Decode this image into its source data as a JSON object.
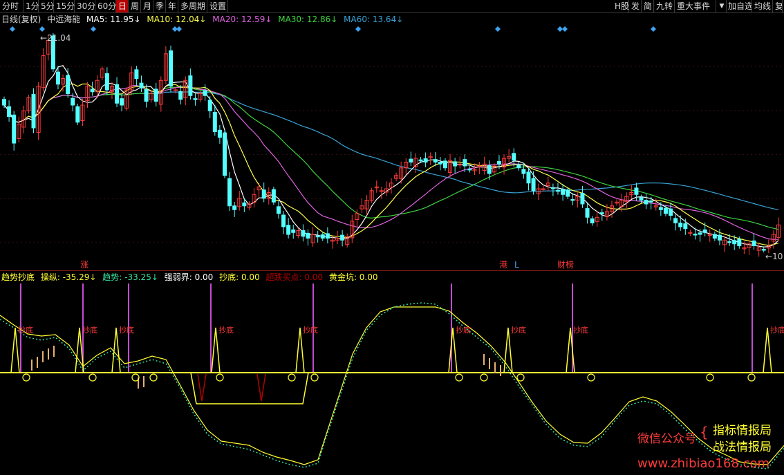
{
  "toolbar": {
    "periods": [
      "分时",
      "1分",
      "5分",
      "15分",
      "30分",
      "60分",
      "日",
      "周",
      "月",
      "季",
      "年",
      "多周期",
      "设置"
    ],
    "active_period": "日",
    "right_items": [
      "H股",
      "发",
      "简",
      "九转",
      "重大事件"
    ],
    "far_right": [
      "加自选",
      "均线",
      "复"
    ]
  },
  "main_info": {
    "chart_kind": "日线(复权)",
    "stock": "中远海能",
    "ma5": "MA5: 11.95↓",
    "ma10": "MA10: 12.04↓",
    "ma20": "MA20: 12.59↓",
    "ma30": "MA30: 12.86↓",
    "ma60": "MA60: 13.64↓"
  },
  "main_labels": {
    "high_price": "21.04",
    "low_price": "10",
    "events": [
      "涨",
      "港",
      "L",
      "财榜"
    ]
  },
  "sub_info": {
    "name": "趋势抄底",
    "caozong": "操纵: -35.29↓",
    "qushi": "趋势: -33.25↓",
    "qiangruo": "强弱界: 0.00",
    "chaodi": "抄底: 0.00",
    "chaodie": "超跌买点: 0.00",
    "huangjin": "黄金坑: 0.00"
  },
  "signal_label": "抄底",
  "watermark": {
    "wechat": "微信公众号",
    "line1": "指标情报局",
    "line2": "战法情报局",
    "url": "www.zhibiao168.com"
  },
  "colors": {
    "background": "#000000",
    "up": "#ff3b3b",
    "down": "#54ffff",
    "ma5": "#ffffff",
    "ma10": "#ffff4a",
    "ma20": "#e062e0",
    "ma30": "#3fd43f",
    "ma60": "#38a3d6",
    "signal_yellow": "#ffff32",
    "marker_purple": "#c44bd2",
    "dotted_line": "#34e0a0",
    "diamond": "#3fa3f0"
  },
  "chart_data": {
    "type": "candlestick",
    "price_axis_labels": {
      "high": 21.04,
      "low": 10
    },
    "moving_averages": [
      {
        "name": "MA5",
        "value": 11.95
      },
      {
        "name": "MA10",
        "value": 12.04
      },
      {
        "name": "MA20",
        "value": 12.59
      },
      {
        "name": "MA30",
        "value": 12.86
      },
      {
        "name": "MA60",
        "value": 13.64
      }
    ],
    "closes": [
      17.6,
      17.0,
      15.6,
      16.6,
      17.3,
      18.0,
      16.4,
      18.6,
      20.2,
      21.0,
      19.5,
      18.7,
      19.0,
      18.2,
      17.6,
      16.7,
      17.6,
      18.6,
      18.3,
      18.9,
      19.5,
      18.4,
      18.6,
      17.7,
      17.6,
      18.4,
      19.3,
      19.0,
      18.5,
      17.8,
      18.2,
      17.8,
      18.9,
      20.3,
      18.6,
      18.4,
      17.9,
      18.9,
      18.1,
      17.9,
      18.2,
      18.1,
      17.3,
      16.2,
      15.9,
      13.9,
      12.3,
      12.1,
      12.7,
      12.3,
      12.4,
      12.9,
      13.3,
      12.7,
      13.0,
      12.5,
      11.9,
      11.2,
      10.8,
      10.9,
      11.0,
      10.7,
      10.6,
      10.8,
      10.7,
      10.6,
      10.6,
      10.5,
      10.6,
      10.5,
      10.7,
      11.5,
      11.9,
      12.3,
      12.6,
      13.1,
      13.3,
      13.1,
      13.2,
      13.5,
      13.9,
      14.3,
      14.6,
      14.6,
      14.8,
      14.7,
      14.6,
      14.9,
      14.6,
      14.5,
      14.3,
      14.7,
      14.4,
      14.5,
      14.4,
      14.2,
      14.2,
      14.4,
      14.5,
      14.0,
      14.4,
      14.5,
      14.8,
      14.9,
      14.7,
      14.3,
      14.0,
      13.5,
      13.1,
      13.2,
      13.2,
      13.5,
      13.2,
      13.1,
      12.9,
      12.8,
      12.6,
      12.8,
      12.4,
      11.7,
      11.4,
      11.7,
      11.9,
      12.0,
      12.3,
      12.5,
      12.6,
      12.8,
      13.0,
      12.9,
      12.6,
      12.4,
      12.5,
      12.3,
      12.1,
      11.9,
      11.8,
      11.4,
      11.2,
      11.1,
      10.9,
      10.8,
      10.8,
      10.9,
      10.8,
      10.6,
      10.5,
      10.5,
      10.4,
      10.3,
      10.2,
      10.1,
      10.3,
      10.2,
      10.1,
      10.0,
      10.2,
      10.8,
      11.3
    ]
  }
}
